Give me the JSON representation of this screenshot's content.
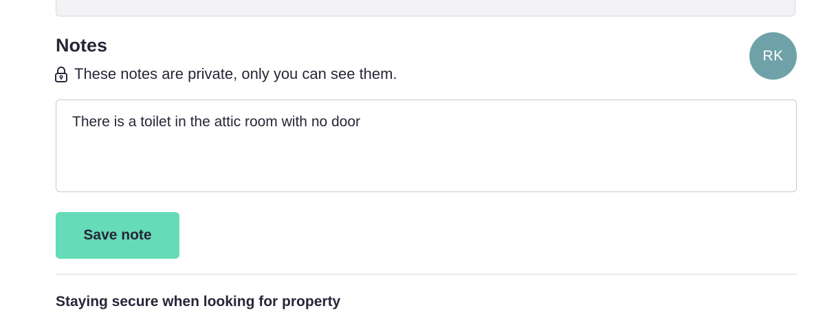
{
  "notes": {
    "title": "Notes",
    "privacy_text": "These notes are private, only you can see them.",
    "privacy_icon": "lock-icon",
    "note_value": "There is a toilet in the attic room with no door",
    "save_label": "Save note"
  },
  "avatar": {
    "initials": "RK",
    "color": "#6fa2a8"
  },
  "next_section": {
    "heading": "Staying secure when looking for property"
  },
  "colors": {
    "accent_button": "#66dbb8",
    "text": "#262637",
    "border": "#c8c8ce"
  }
}
